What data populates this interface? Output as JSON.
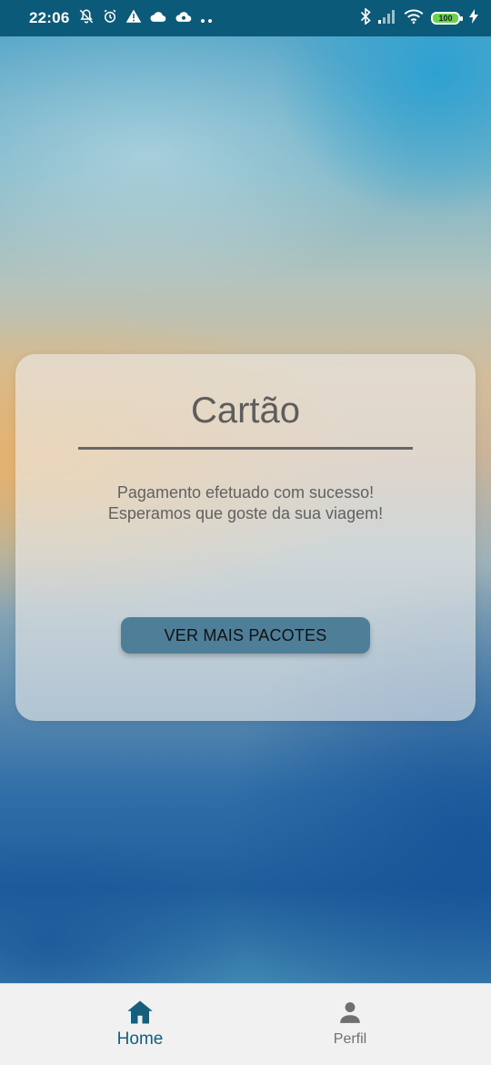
{
  "status_bar": {
    "time": "22:06",
    "battery": "100",
    "icons": [
      "notifications-off-icon",
      "alarm-icon",
      "warning-icon",
      "cloud-icon",
      "cloud-sync-icon",
      "more-dots-icon",
      "bluetooth-icon",
      "signal-icon",
      "wifi-icon",
      "battery-icon",
      "charging-icon"
    ]
  },
  "card": {
    "title": "Cartão",
    "message_line1": "Pagamento efetuado com sucesso!",
    "message_line2": "Esperamos que goste da sua viagem!",
    "button_label": "VER MAIS PACOTES"
  },
  "bottom_nav": {
    "items": [
      {
        "label": "Home",
        "icon": "home-icon",
        "active": true
      },
      {
        "label": "Perfil",
        "icon": "person-icon",
        "active": false
      }
    ]
  },
  "colors": {
    "status_bar": "#0c5a79",
    "active_nav": "#155e7e",
    "inactive_nav": "#6f6f6f",
    "button": "#4e7e98"
  }
}
